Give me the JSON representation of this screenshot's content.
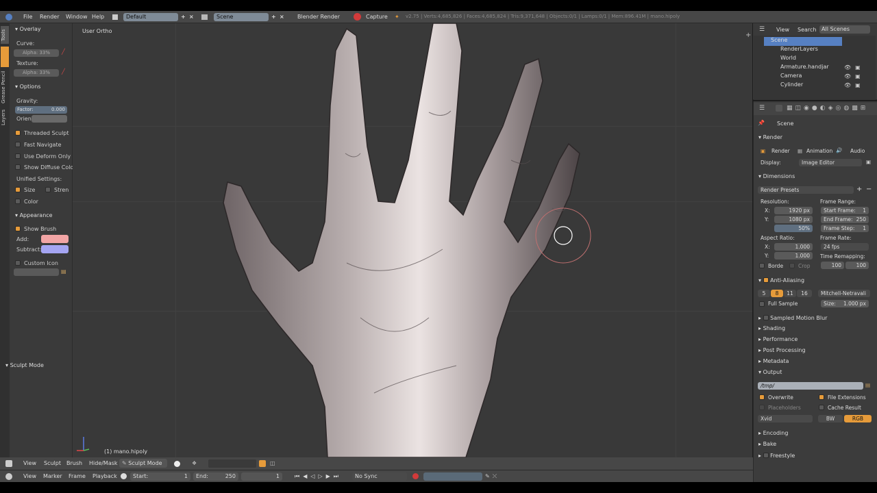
{
  "top_menu": {
    "items": [
      "File",
      "Render",
      "Window",
      "Help"
    ],
    "layout": "Default",
    "scene": "Scene",
    "engine": "Blender Render",
    "capture": "Capture",
    "stats": "v2.75 | Verts:4,685,826 | Faces:4,685,824 | Tris:9,371,648 | Objects:0/1 | Lamps:0/1 | Mem:896.41M | mano.hipoly"
  },
  "tool_tabs": [
    "Tools",
    "Grease Pencil",
    "Layers"
  ],
  "toolshelf": {
    "overlay": "Overlay",
    "curve": "Curve:",
    "curve_val": "Alpha: 33%",
    "texture": "Texture:",
    "texture_val": "Alpha: 33%",
    "options": "Options",
    "gravity": "Gravity:",
    "factor": "Factor:",
    "factor_val": "0.000",
    "orient": "Orient",
    "threaded": "Threaded Sculpt",
    "fast_nav": "Fast Navigate",
    "deform": "Use Deform Only",
    "diffuse": "Show Diffuse Color",
    "unified": "Unified Settings:",
    "size": "Size",
    "stren": "Stren",
    "color": "Color",
    "appearance": "Appearance",
    "show_brush": "Show Brush",
    "add": "Add:",
    "subtract": "Subtract:",
    "custom_icon": "Custom Icon",
    "sculpt_mode": "Sculpt Mode",
    "add_color": "#f2a5a5",
    "sub_color": "#a5a5f2"
  },
  "viewport": {
    "view_name": "User Ortho",
    "object_name": "(1) mano.hipoly"
  },
  "outliner": {
    "view": "View",
    "search": "Search",
    "all_scenes": "All Scenes",
    "items": [
      "Scene",
      "RenderLayers",
      "World",
      "Armature.handjar",
      "Camera",
      "Cylinder"
    ]
  },
  "properties": {
    "scene": "Scene",
    "render": "Render",
    "render_btn": "Render",
    "animation_btn": "Animation",
    "audio_btn": "Audio",
    "display": "Display:",
    "display_val": "Image Editor",
    "dimensions": "Dimensions",
    "render_presets": "Render Presets",
    "resolution": "Resolution:",
    "res_x": "1920 px",
    "res_y": "1080 px",
    "res_pct": "50%",
    "frame_range": "Frame Range:",
    "start_frame": "Start Frame:",
    "start_frame_val": "1",
    "end_frame": "End Frame:",
    "end_frame_val": "250",
    "frame_step": "Frame Step:",
    "frame_step_val": "1",
    "aspect": "Aspect Ratio:",
    "asp_x": "1.000",
    "asp_y": "1.000",
    "frame_rate": "Frame Rate:",
    "fps": "24 fps",
    "time_remap": "Time Remapping:",
    "remap_a": "100",
    "remap_b": "100",
    "border": "Borde",
    "crop": "Crop",
    "anti_aliasing": "Anti-Aliasing",
    "aa_values": [
      "5",
      "8",
      "11",
      "16"
    ],
    "aa_filter": "Mitchell-Netravali",
    "full_sample": "Full Sample",
    "size_lbl": "Size:",
    "size_val": "1.000 px",
    "motion_blur": "Sampled Motion Blur",
    "shading": "Shading",
    "performance": "Performance",
    "post_processing": "Post Processing",
    "metadata": "Metadata",
    "output": "Output",
    "output_path": "/tmp/",
    "overwrite": "Overwrite",
    "file_ext": "File Extensions",
    "placeholders": "Placeholders",
    "cache_result": "Cache Result",
    "codec": "Xvid",
    "bw": "BW",
    "rgb": "RGB",
    "encoding": "Encoding",
    "bake": "Bake",
    "freestyle": "Freestyle"
  },
  "header3d": {
    "items": [
      "View",
      "Sculpt",
      "Brush",
      "Hide/Mask"
    ],
    "mode": "Sculpt Mode"
  },
  "timeline": {
    "items": [
      "View",
      "Marker",
      "Frame",
      "Playback"
    ],
    "start": "Start:",
    "start_val": "1",
    "end": "End:",
    "end_val": "250",
    "current": "1",
    "sync": "No Sync"
  },
  "colors": {
    "accent": "#e69b3a",
    "select": "#5680c2"
  }
}
